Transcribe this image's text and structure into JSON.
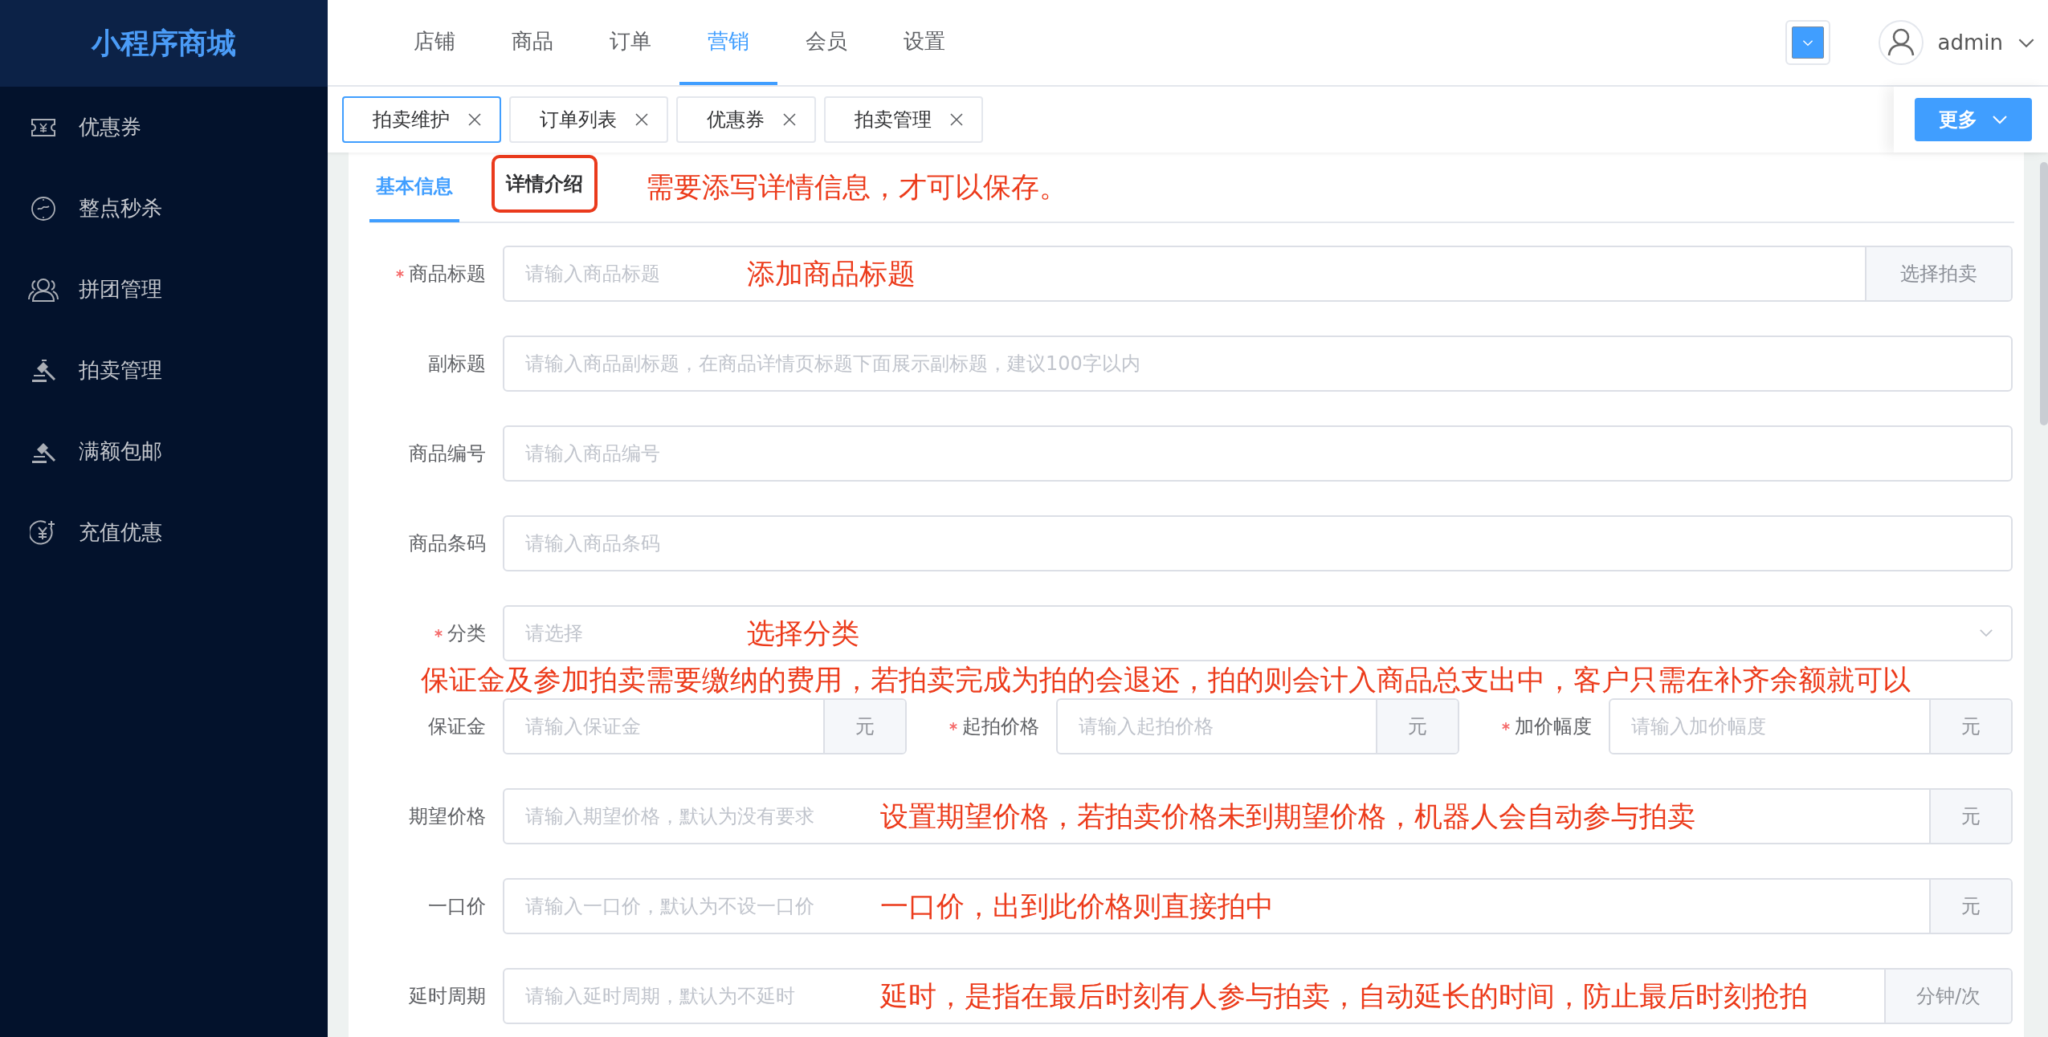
{
  "sidebar": {
    "logo": "小程序商城",
    "items": [
      {
        "label": "优惠券",
        "selected": false
      },
      {
        "label": "整点秒杀",
        "selected": false
      },
      {
        "label": "拼团管理",
        "selected": false
      },
      {
        "label": "拍卖管理",
        "selected": false
      },
      {
        "label": "满额包邮",
        "selected": false
      },
      {
        "label": "充值优惠",
        "selected": false
      }
    ]
  },
  "top_nav": [
    {
      "label": "店铺",
      "selected": false
    },
    {
      "label": "商品",
      "selected": false
    },
    {
      "label": "订单",
      "selected": false
    },
    {
      "label": "营销",
      "selected": true
    },
    {
      "label": "会员",
      "selected": false
    },
    {
      "label": "设置",
      "selected": false
    }
  ],
  "user": {
    "name": "admin"
  },
  "tabs": [
    {
      "label": "拍卖维护",
      "selected": true
    },
    {
      "label": "订单列表",
      "selected": false
    },
    {
      "label": "优惠券",
      "selected": false
    },
    {
      "label": "拍卖管理",
      "selected": false
    }
  ],
  "more_button": "更多",
  "form_tabs": [
    {
      "label": "基本信息",
      "selected": true,
      "highlighted": false
    },
    {
      "label": "详情介绍",
      "selected": false,
      "highlighted": true
    }
  ],
  "form_tabs_note": "需要添写详情信息，才可以保存。",
  "form_rows": [
    {
      "kind": "input",
      "label": "商品标题",
      "required": true,
      "placeholder": "请输入商品标题",
      "annotation": "添加商品标题",
      "addon": {
        "kind": "button",
        "text": "选择拍卖"
      }
    },
    {
      "kind": "input",
      "label": "副标题",
      "required": false,
      "placeholder": "请输入商品副标题，在商品详情页标题下面展示副标题，建议100字以内"
    },
    {
      "kind": "input",
      "label": "商品编号",
      "required": false,
      "placeholder": "请输入商品编号"
    },
    {
      "kind": "input",
      "label": "商品条码",
      "required": false,
      "placeholder": "请输入商品条码"
    },
    {
      "kind": "select",
      "label": "分类",
      "required": true,
      "placeholder": "请选择",
      "annotation": "选择分类"
    },
    {
      "kind": "note",
      "text": "保证金及参加拍卖需要缴纳的费用，若拍卖完成为拍的会退还，拍的则会计入商品总支出中，客户只需在补齐余额就可以"
    },
    {
      "kind": "group",
      "fields": [
        {
          "kind": "input",
          "label": "保证金",
          "required": false,
          "placeholder": "请输入保证金",
          "addon": {
            "kind": "unit",
            "text": "元"
          }
        },
        {
          "kind": "input",
          "label": "起拍价格",
          "required": true,
          "placeholder": "请输入起拍价格",
          "addon": {
            "kind": "unit",
            "text": "元"
          }
        },
        {
          "kind": "input",
          "label": "加价幅度",
          "required": true,
          "placeholder": "请输入加价幅度",
          "addon": {
            "kind": "unit",
            "text": "元"
          }
        }
      ]
    },
    {
      "kind": "input",
      "label": "期望价格",
      "required": false,
      "placeholder": "请输入期望价格，默认为没有要求",
      "annotation": "设置期望价格，若拍卖价格未到期望价格，机器人会自动参与拍卖",
      "addon": {
        "kind": "unit",
        "text": "元"
      }
    },
    {
      "kind": "input",
      "label": "一口价",
      "required": false,
      "placeholder": "请输入一口价，默认为不设一口价",
      "annotation": "一口价，出到此价格则直接拍中",
      "addon": {
        "kind": "unit",
        "text": "元"
      }
    },
    {
      "kind": "input",
      "label": "延时周期",
      "required": false,
      "placeholder": "请输入延时周期，默认为不延时",
      "annotation": "延时，是指在最后时刻有人参与拍卖，自动延长的时间，防止最后时刻抢拍",
      "addon": {
        "kind": "unit",
        "text": "分钟/次"
      }
    }
  ]
}
